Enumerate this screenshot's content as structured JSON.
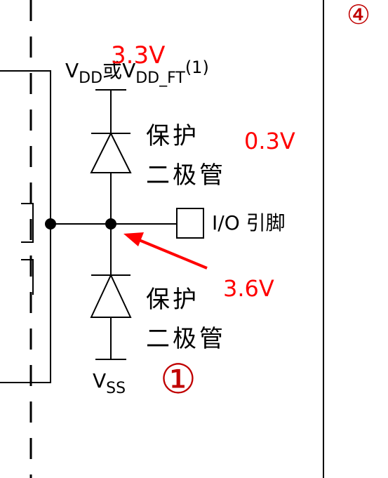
{
  "supply": {
    "v_main": "V",
    "v_main_sub": "DD",
    "or_text": "或",
    "v_ft": "V",
    "v_ft_sub": "DD_FT",
    "footnote": "(1)"
  },
  "ground": {
    "v_main": "V",
    "v_sub": "SS"
  },
  "diodes": {
    "top": {
      "line1": "保护",
      "line2": "二极管"
    },
    "bottom": {
      "line1": "保护",
      "line2": "二极管"
    }
  },
  "pin": {
    "label": "I/O 引脚"
  },
  "annotations": {
    "voltage_top": "3.3V",
    "voltage_diode": "0.3V",
    "voltage_pin": "3.6V",
    "circle_1": "①",
    "circle_4": "④",
    "color": "#ff0000",
    "circle_color": "#c00000"
  }
}
